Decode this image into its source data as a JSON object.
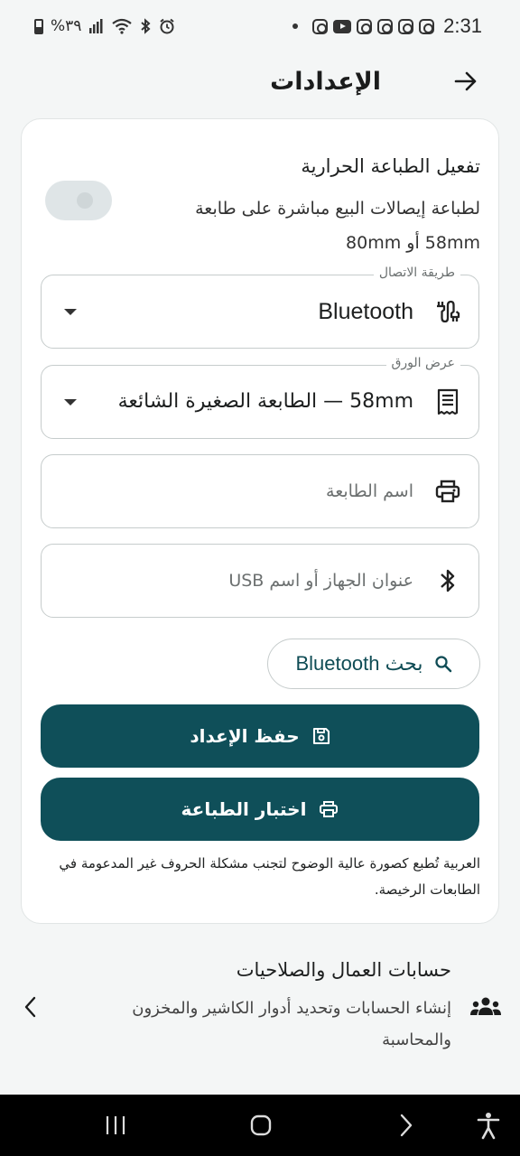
{
  "status_bar": {
    "time": "2:31",
    "battery_percent": "%٣٩"
  },
  "app_bar": {
    "title": "الإعدادات"
  },
  "printer_card": {
    "toggle_title": "تفعيل الطباعة الحرارية",
    "toggle_description": "لطباعة إيصالات البيع مباشرة على طابعة 58mm أو 80mm",
    "toggle_on": false,
    "connection_field": {
      "label": "طريقة الاتصال",
      "value": "Bluetooth"
    },
    "paper_field": {
      "label": "عرض الورق",
      "value": "58mm — الطابعة الصغيرة الشائعة"
    },
    "printer_name_field": {
      "placeholder": "اسم الطابعة"
    },
    "device_address_field": {
      "placeholder": "عنوان الجهاز أو اسم USB"
    },
    "scan_button": "بحث Bluetooth",
    "save_button": "حفظ الإعداد",
    "test_button": "اختبار الطباعة",
    "note": "العربية تُطبع كصورة عالية الوضوح لتجنب مشكلة الحروف غير المدعومة في الطابعات الرخيصة."
  },
  "employees_item": {
    "title": "حسابات العمال والصلاحيات",
    "description": "إنشاء الحسابات وتحديد أدوار الكاشير والمخزون والمحاسبة"
  },
  "colors": {
    "primary": "#0f4f59",
    "background": "#f4f6f6",
    "card": "#ffffff"
  }
}
